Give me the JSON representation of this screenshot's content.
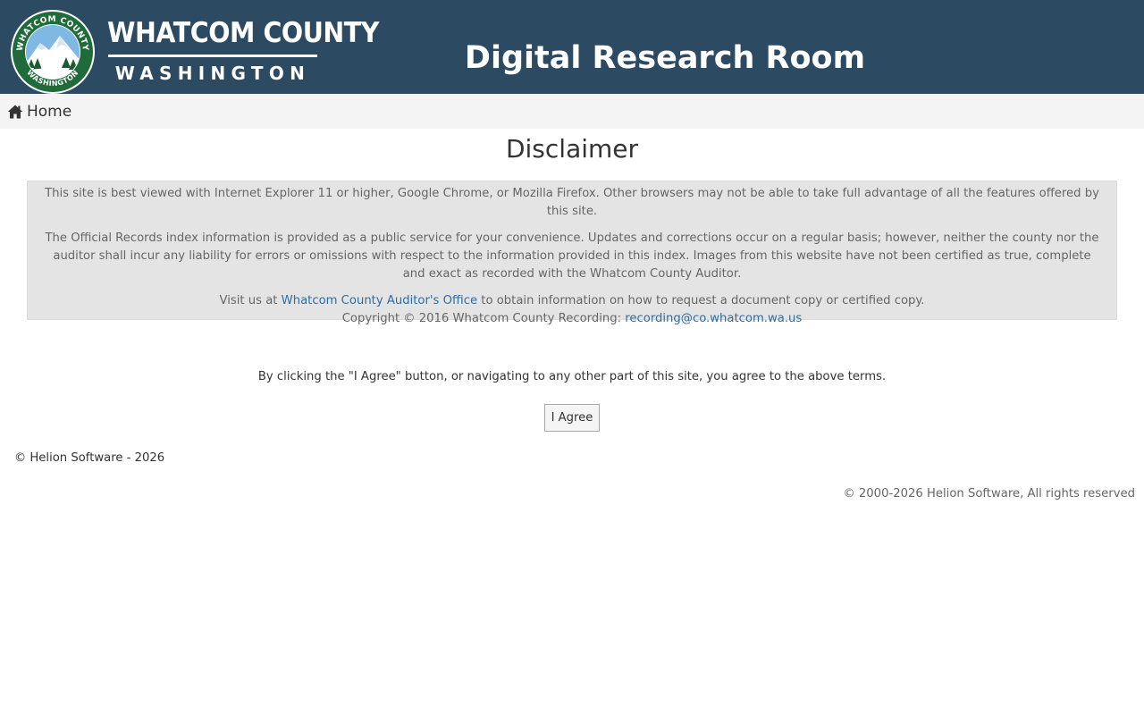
{
  "header": {
    "county_name": "WHATCOM COUNTY",
    "state_name": "WASHINGTON",
    "site_title": "Digital Research Room",
    "seal": {
      "top_text": "WHATCOM COUNTY",
      "bottom_text": "WASHINGTON",
      "ring_color": "#1f6b3a"
    },
    "background_color": "#2d4a63"
  },
  "nav": {
    "home_label": "Home",
    "home_icon": "home-icon"
  },
  "main": {
    "heading": "Disclaimer",
    "disclaimer": {
      "browser_notice": "This site is best viewed with Internet Explorer 11 or higher, Google Chrome, or Mozilla Firefox. Other browsers may not be able to take full advantage of all the features offered by this site.",
      "liability_notice": "The Official Records index information is provided as a public service for your convenience. Updates and corrections occur on a regular basis; however, neither the county nor the auditor shall incur any liability for errors or omissions with respect to the information provided in this index. Images from this website have not been certified as true, complete and exact as recorded with the Whatcom County Auditor.",
      "visit_prefix": "Visit us at ",
      "visit_link": "Whatcom County Auditor's Office",
      "visit_suffix": " to obtain information on how to request a document copy or certified copy.",
      "copyright_prefix": "Copyright © 2016 Whatcom County Recording: ",
      "copyright_email": "recording@co.whatcom.wa.us"
    },
    "agree_text": "By clicking the \"I Agree\" button, or navigating to any other part of this site, you agree to the above terms.",
    "agree_button": "I Agree"
  },
  "footer": {
    "left": "© Helion Software - 2026",
    "right": "© 2000-2026 Helion Software, All rights reserved"
  },
  "colors": {
    "link": "#2e6da4",
    "disclaimer_bg": "#e4e4e4",
    "nav_bg": "#f4f4f4"
  }
}
